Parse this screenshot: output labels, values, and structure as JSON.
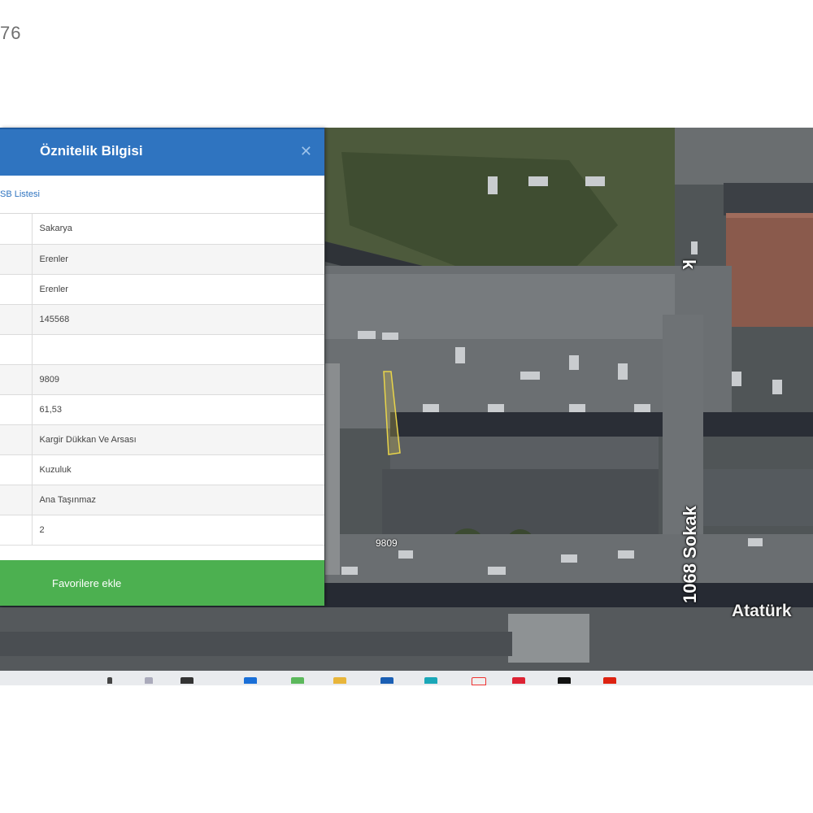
{
  "page_number": "76",
  "panel": {
    "title": "Öznitelik Bilgisi",
    "close_icon": "close-icon",
    "sub_link": "SB Listesi",
    "rows": [
      "Sakarya",
      "Erenler",
      "Erenler",
      "145568",
      "",
      "9809",
      "61,53",
      "Kargir Dükkan Ve Arsası",
      "Kuzuluk",
      "Ana Taşınmaz",
      "2"
    ],
    "favorite_button": "Favorilere ekle",
    "colors": {
      "header": "#2f74c0",
      "button": "#4cb050"
    }
  },
  "map": {
    "street_label": "1068 Sokak",
    "street_label_top": "k",
    "avenue_label": "Atatürk",
    "parcel_label": "9809"
  },
  "taskbar": {
    "icons": [
      "pin-icon",
      "folder-icon",
      "app-icon",
      "edge-icon",
      "chrome-icon",
      "files-icon",
      "shield-icon",
      "browser-icon",
      "app-icon",
      "mail-icon",
      "media-icon",
      "settings-icon"
    ]
  }
}
